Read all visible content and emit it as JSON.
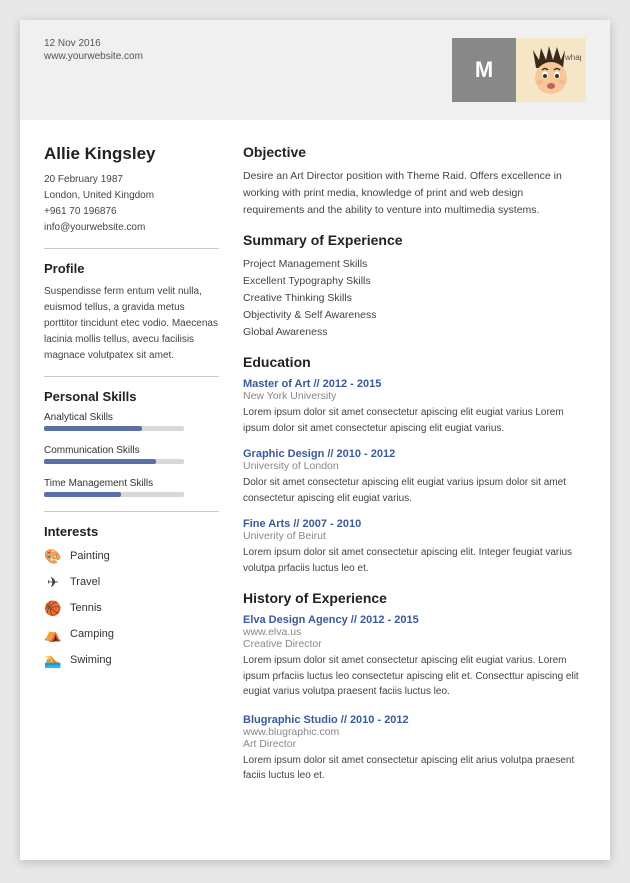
{
  "header": {
    "date": "12 Nov 2016",
    "website": "www.yourwebsite.com",
    "monogram": "M"
  },
  "person": {
    "name": "Allie Kingsley",
    "dob": "20 February 1987",
    "location": "London, United Kingdom",
    "phone": "+961 70 196876",
    "email": "info@yourwebsite.com"
  },
  "profile": {
    "title": "Profile",
    "text": "Suspendisse ferm entum velit nulla, euismod tellus, a gravida metus porttitor tincidunt etec vodio. Maecenas lacinia mollis tellus, avecu facilisis magnace volutpatex sit amet."
  },
  "personal_skills": {
    "title": "Personal Skills",
    "skills": [
      {
        "label": "Analytical Skills",
        "percent": 70
      },
      {
        "label": "Communication Skills",
        "percent": 80
      },
      {
        "label": "Time Management Skills",
        "percent": 55
      }
    ]
  },
  "interests": {
    "title": "Interests",
    "items": [
      {
        "icon": "🎨",
        "label": "Painting"
      },
      {
        "icon": "✈",
        "label": "Travel"
      },
      {
        "icon": "🏀",
        "label": "Tennis"
      },
      {
        "icon": "⛺",
        "label": "Camping"
      },
      {
        "icon": "🏊",
        "label": "Swiming"
      }
    ]
  },
  "objective": {
    "title": "Objective",
    "text": "Desire an Art Director position with Theme Raid. Offers excellence in working with print media, knowledge of print and web design requirements and the ability to venture into multimedia systems."
  },
  "summary": {
    "title": "Summary of Experience",
    "items": [
      "Project Management Skills",
      "Excellent Typography Skills",
      "Creative Thinking Skills",
      "Objectivity & Self Awareness",
      "Global Awareness"
    ]
  },
  "education": {
    "title": "Education",
    "entries": [
      {
        "degree": "Master of Art // 2012 - 2015",
        "school": "New York University",
        "desc": "Lorem ipsum dolor sit amet consectetur apiscing elit eugiat varius Lorem ipsum dolor sit amet consectetur apiscing elit eugiat varius."
      },
      {
        "degree": "Graphic Design // 2010 - 2012",
        "school": "University of London",
        "desc": "Dolor sit amet consectetur apiscing elit eugiat varius  ipsum dolor sit amet consectetur apiscing elit eugiat varius."
      },
      {
        "degree": "Fine Arts // 2007 - 2010",
        "school": "Univerity of Beirut",
        "desc": "Lorem ipsum dolor sit amet consectetur apiscing elit. Integer feugiat varius volutpa prfaciis luctus leo et."
      }
    ]
  },
  "experience": {
    "title": "History of Experience",
    "entries": [
      {
        "company_title": "Elva Design Agency // 2012 - 2015",
        "website": "www.elva.us",
        "role": "Creative Director",
        "desc": "Lorem ipsum dolor sit amet consectetur apiscing elit eugiat varius. Lorem ipsum prfaciis luctus leo consectetur apiscing elit et. Consecttur apiscing elit eugiat varius volutpa praesent faciis luctus leo."
      },
      {
        "company_title": "Blugraphic Studio // 2010 - 2012",
        "website": "www.blugraphic.com",
        "role": "Art Director",
        "desc": "Lorem ipsum dolor sit amet consectetur apiscing elit arius volutpa praesent faciis luctus leo et."
      }
    ]
  }
}
